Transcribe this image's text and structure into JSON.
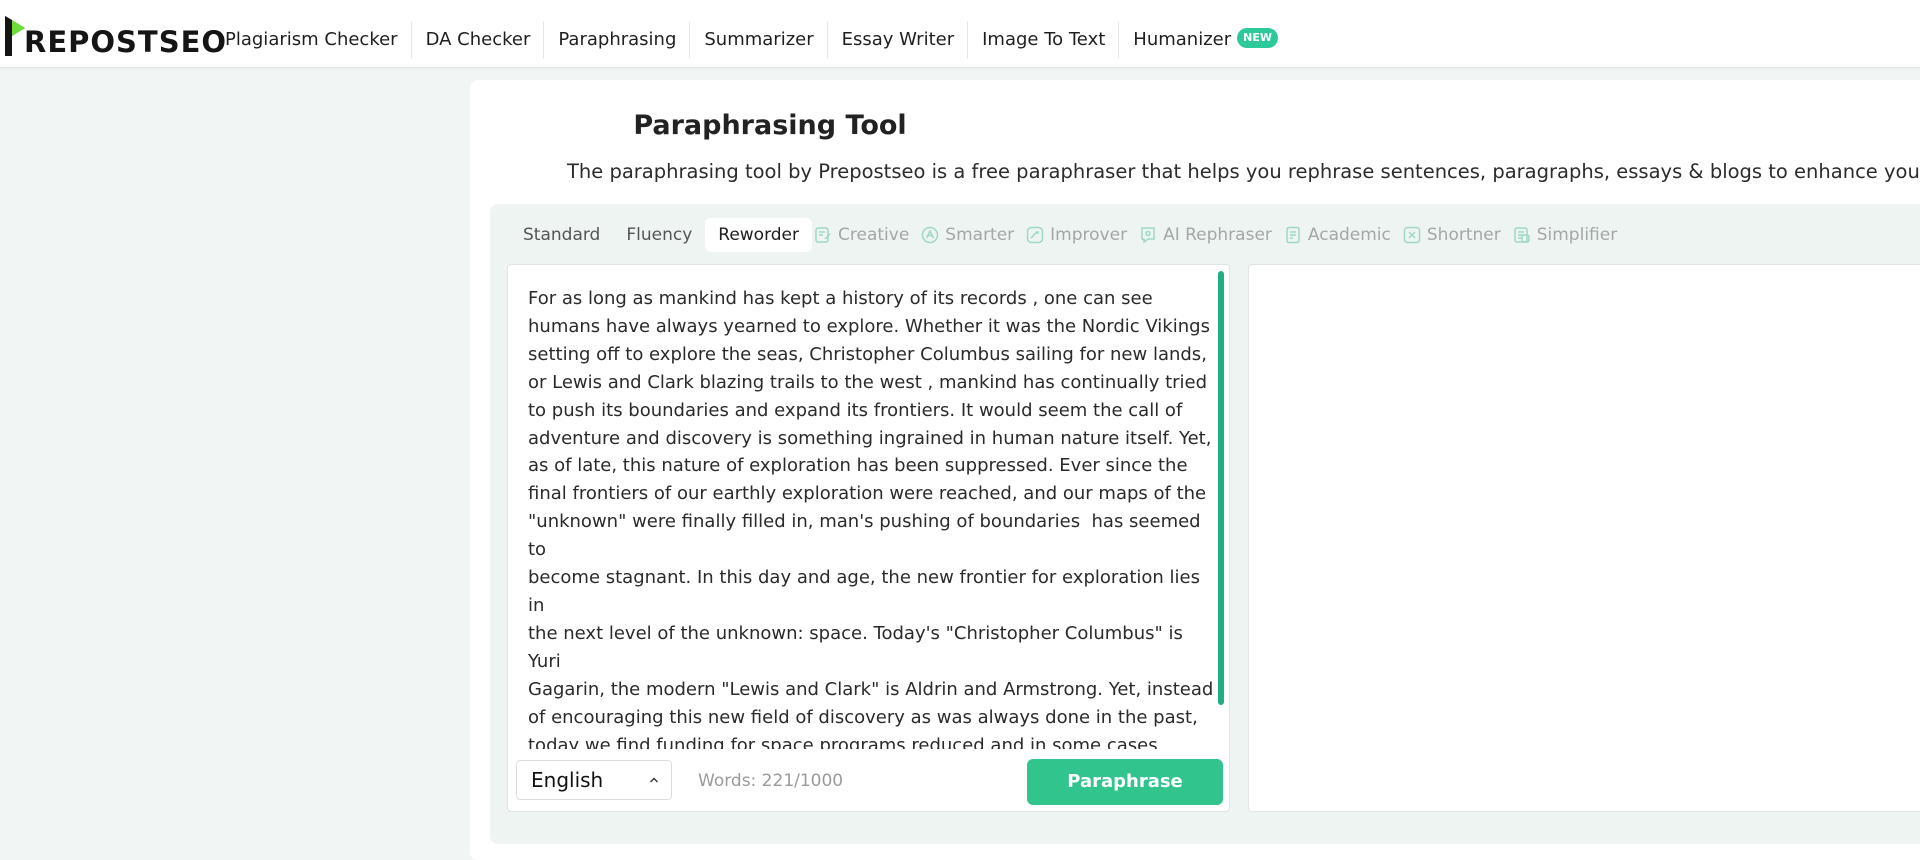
{
  "brand": {
    "logo_text": "REPOSTSEO",
    "logo_mark": "P",
    "accent": "#2ec99a",
    "button_color": "#31c48d"
  },
  "nav": {
    "items": [
      {
        "label": "Plagiarism Checker"
      },
      {
        "label": "DA Checker"
      },
      {
        "label": "Paraphrasing"
      },
      {
        "label": "Summarizer"
      },
      {
        "label": "Essay Writer"
      },
      {
        "label": "Image To Text"
      },
      {
        "label": "Humanizer",
        "badge": "NEW"
      }
    ]
  },
  "page": {
    "title": "Paraphrasing Tool",
    "subtitle": "The paraphrasing tool by Prepostseo is a free paraphraser that helps you rephrase sentences, paragraphs, essays & blogs to enhance your writing."
  },
  "modes": [
    {
      "label": "Standard",
      "state": "normal"
    },
    {
      "label": "Fluency",
      "state": "normal"
    },
    {
      "label": "Reworder",
      "state": "active"
    },
    {
      "label": "Creative",
      "state": "locked",
      "icon": "creative-icon"
    },
    {
      "label": "Smarter",
      "state": "locked",
      "icon": "smarter-icon"
    },
    {
      "label": "Improver",
      "state": "locked",
      "icon": "improver-icon"
    },
    {
      "label": "AI Rephraser",
      "state": "locked",
      "icon": "ai-rephraser-icon"
    },
    {
      "label": "Academic",
      "state": "locked",
      "icon": "academic-icon"
    },
    {
      "label": "Shortner",
      "state": "locked",
      "icon": "shortner-icon"
    },
    {
      "label": "Simplifier",
      "state": "locked",
      "icon": "simplifier-icon"
    }
  ],
  "editor": {
    "text": "For as long as mankind has kept a history of its records , one can see\nhumans have always yearned to explore. Whether it was the Nordic Vikings\nsetting off to explore the seas, Christopher Columbus sailing for new lands,\nor Lewis and Clark blazing trails to the west , mankind has continually tried\nto push its boundaries and expand its frontiers. It would seem the call of\nadventure and discovery is something ingrained in human nature itself. Yet,\nas of late, this nature of exploration has been suppressed. Ever since the\nfinal frontiers of our earthly exploration were reached, and our maps of the\n\"unknown\" were finally filled in, man's pushing of boundaries  has seemed to\nbecome stagnant. In this day and age, the new frontier for exploration lies in\nthe next level of the unknown: space. Today's \"Christopher Columbus\" is Yuri\nGagarin, the modern \"Lewis and Clark\" is Aldrin and Armstrong. Yet, instead\nof encouraging this new field of discovery as was always done in the past,\ntoday we find funding for space programs reduced and in some cases\ncompletely discontinued. Is this the way man's exploration and innovation\nshould be treated? Certainly not. Therefore, despite the protests of the\nopposition, funding for space programs must not be cut, as this would",
    "language": "English",
    "word_count": "Words: 221/1000",
    "button_label": "Paraphrase"
  }
}
